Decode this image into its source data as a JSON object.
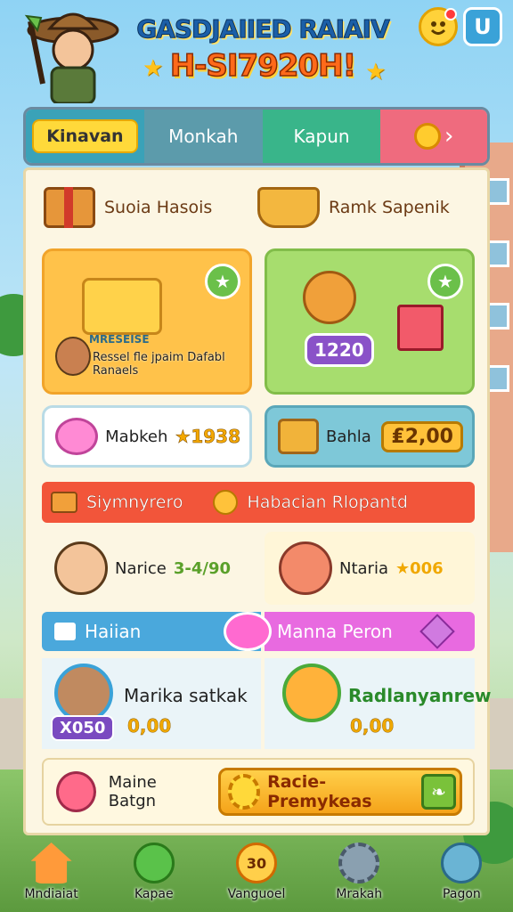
{
  "header": {
    "title_line1": "GASDJAIIED RAIAIV",
    "title_line2": "H-SI7920H!",
    "star_left": "★",
    "star_right": "★",
    "menu_glyph": "U"
  },
  "tabs": [
    {
      "label": "Kinavan"
    },
    {
      "label": "Monkah"
    },
    {
      "label": "Kapun"
    },
    {
      "label": "›"
    }
  ],
  "shop_top": [
    {
      "label": "Suoia Hasois"
    },
    {
      "label": "Ramk Sapenik"
    }
  ],
  "cards": {
    "orange": {
      "sign": "MRESEISE",
      "caption": "Ressel fle jpaim Dafabl Ranaels"
    },
    "green": {
      "amount": "1220"
    },
    "pink": {
      "label": "Mabkeh",
      "price": "★1938"
    },
    "teal": {
      "label": "Bahla",
      "price": "₤2,00"
    }
  },
  "banner_red": {
    "left": "Siymnyrero",
    "right": "Habacian Rlopantd"
  },
  "char_row1": [
    {
      "name": "Narice",
      "value": "3-4/90"
    },
    {
      "name": "Ntaria",
      "value": "★006"
    }
  ],
  "banner_blue": {
    "label": "Haiian"
  },
  "banner_pink": {
    "label": "Manna Peron"
  },
  "char_row2": [
    {
      "name": "Marika satkak",
      "badge": "X050",
      "value": "0,00"
    },
    {
      "name": "Radlanyanrew",
      "value": "0,00"
    }
  ],
  "bottom_card": {
    "name": "Maine Batgn",
    "cta": "Racie- Premykeas"
  },
  "nav": [
    {
      "label": "Mndiaiat"
    },
    {
      "label": "Kapae"
    },
    {
      "label": "Vanguoel",
      "badge": "30"
    },
    {
      "label": "Mrakah"
    },
    {
      "label": "Pagon"
    }
  ]
}
